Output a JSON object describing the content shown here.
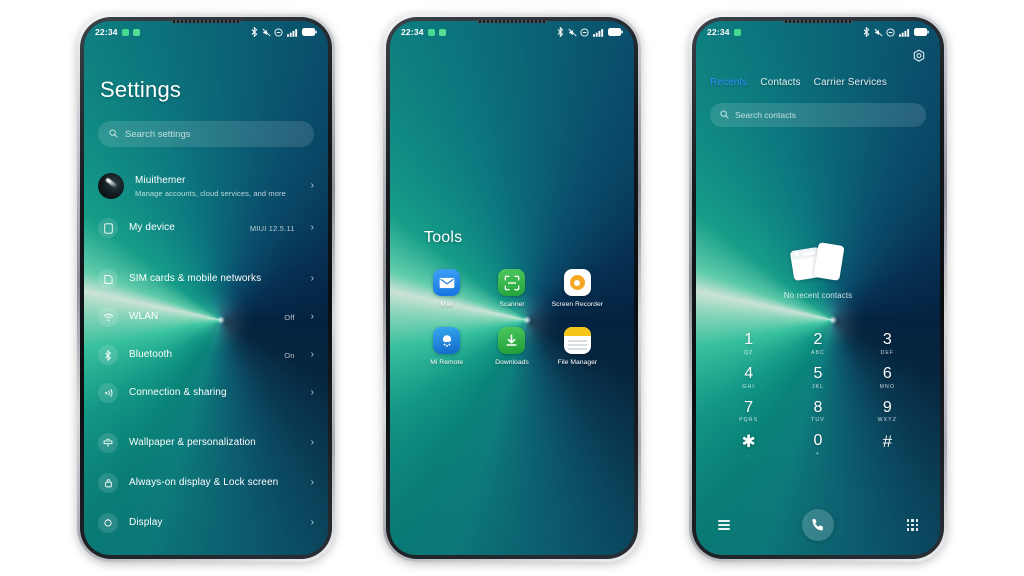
{
  "status_bar": {
    "time": "22:34",
    "left_icons": [
      "app-indicator-icon",
      "app-indicator-icon"
    ],
    "right_icons": [
      "bluetooth-icon",
      "mute-icon",
      "dnd-icon",
      "signal-icon",
      "battery-icon"
    ]
  },
  "phone1": {
    "title": "Settings",
    "search": {
      "placeholder": "Search settings",
      "icon": "search-icon"
    },
    "account": {
      "name": "Miuithemer",
      "subtitle": "Manage accounts, cloud services, and more",
      "chevron": "›"
    },
    "items": [
      {
        "label": "My device",
        "value": "MIUI 12.5.11",
        "icon": "device-icon",
        "chevron": "›"
      },
      {
        "label": "SIM cards & mobile networks",
        "value": "",
        "icon": "sim-icon",
        "chevron": "›"
      },
      {
        "label": "WLAN",
        "value": "Off",
        "icon": "wifi-icon",
        "chevron": "›"
      },
      {
        "label": "Bluetooth",
        "value": "On",
        "icon": "bluetooth-icon",
        "chevron": "›"
      },
      {
        "label": "Connection & sharing",
        "value": "",
        "icon": "connection-sharing-icon",
        "chevron": "›"
      },
      {
        "label": "Wallpaper & personalization",
        "value": "",
        "icon": "wallpaper-icon",
        "chevron": "›"
      },
      {
        "label": "Always-on display & Lock screen",
        "value": "",
        "icon": "lock-icon",
        "chevron": "›"
      },
      {
        "label": "Display",
        "value": "",
        "icon": "display-icon",
        "chevron": "›"
      }
    ]
  },
  "phone2": {
    "folder_title": "Tools",
    "apps": [
      {
        "name": "Mail",
        "icon": "mail-icon"
      },
      {
        "name": "Scanner",
        "icon": "scanner-icon"
      },
      {
        "name": "Screen Recorder",
        "icon": "screen-recorder-icon"
      },
      {
        "name": "Mi Remote",
        "icon": "mi-remote-icon"
      },
      {
        "name": "Downloads",
        "icon": "downloads-icon"
      },
      {
        "name": "File Manager",
        "icon": "file-manager-icon"
      }
    ]
  },
  "phone3": {
    "settings_icon": "gear-icon",
    "tabs": [
      {
        "label": "Recents",
        "active": true
      },
      {
        "label": "Contacts",
        "active": false
      },
      {
        "label": "Carrier Services",
        "active": false
      }
    ],
    "search": {
      "placeholder": "Search contacts",
      "icon": "search-icon"
    },
    "empty_state": {
      "message": "No recent contacts",
      "icon": "contact-cards-icon"
    },
    "keypad": [
      {
        "digit": "1",
        "letters": "QZ"
      },
      {
        "digit": "2",
        "letters": "ABC"
      },
      {
        "digit": "3",
        "letters": "DEF"
      },
      {
        "digit": "4",
        "letters": "GHI"
      },
      {
        "digit": "5",
        "letters": "JKL"
      },
      {
        "digit": "6",
        "letters": "MNO"
      },
      {
        "digit": "7",
        "letters": "PQRS"
      },
      {
        "digit": "8",
        "letters": "TUV"
      },
      {
        "digit": "9",
        "letters": "WXYZ"
      },
      {
        "digit": "✱",
        "letters": ","
      },
      {
        "digit": "0",
        "letters": "+"
      },
      {
        "digit": "#",
        "letters": ""
      }
    ],
    "bottom_bar": {
      "menu_icon": "menu-icon",
      "call_icon": "call-icon",
      "keypad_icon": "keypad-icon"
    }
  },
  "colors": {
    "accent_blue": "#2f8fff",
    "wall_mint": "#3fd3a8",
    "wall_teal": "#0a8f7e",
    "wall_navy": "#04203f",
    "page_background": "#ffffff"
  }
}
